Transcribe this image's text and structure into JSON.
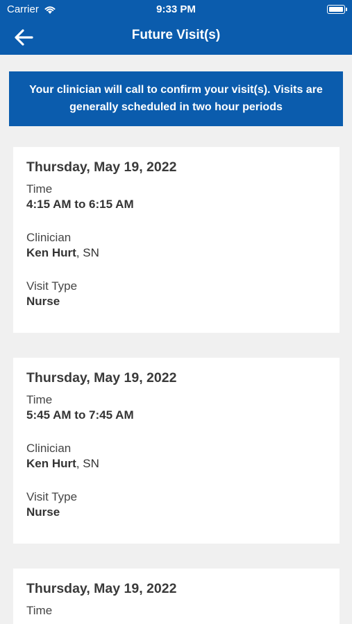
{
  "status_bar": {
    "carrier": "Carrier",
    "time": "9:33 PM",
    "icons": [
      "wifi-icon",
      "battery-icon"
    ]
  },
  "nav": {
    "title": "Future Visit(s)",
    "back_icon": "arrow-left-icon"
  },
  "banner": {
    "text": "Your clinician will call to confirm your visit(s). Visits are generally scheduled in two hour periods"
  },
  "labels": {
    "time": "Time",
    "clinician": "Clinician",
    "visit_type": "Visit Type"
  },
  "visits": [
    {
      "date": "Thursday, May 19, 2022",
      "time": "4:15 AM to 6:15 AM",
      "clinician_name": "Ken Hurt",
      "clinician_role": ", SN",
      "visit_type": "Nurse"
    },
    {
      "date": "Thursday, May 19, 2022",
      "time": "5:45 AM to 7:45 AM",
      "clinician_name": "Ken Hurt",
      "clinician_role": ", SN",
      "visit_type": "Nurse"
    },
    {
      "date": "Thursday, May 19, 2022",
      "time": "",
      "clinician_name": "",
      "clinician_role": "",
      "visit_type": ""
    }
  ],
  "colors": {
    "brand_blue": "#0b5cad",
    "background": "#f0f0f0",
    "card": "#ffffff"
  }
}
